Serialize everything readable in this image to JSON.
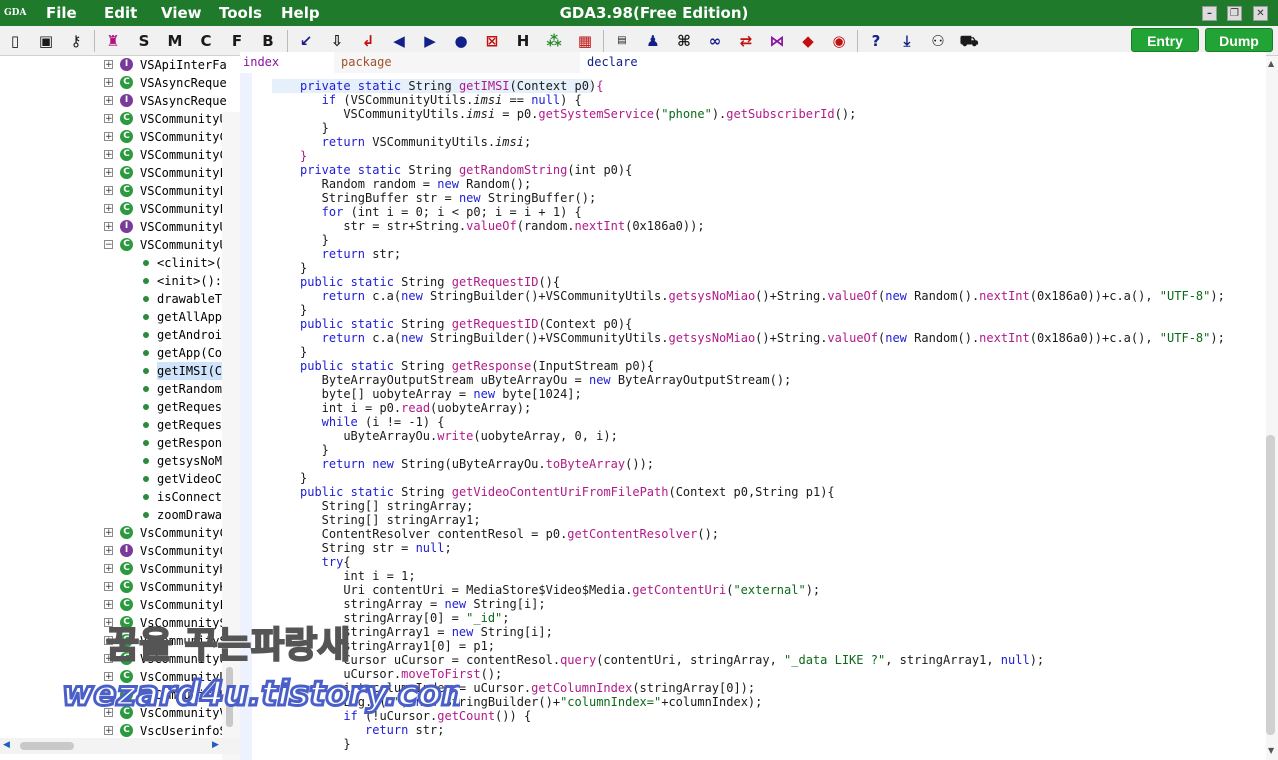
{
  "window": {
    "title": "GDA3.98(Free Edition)",
    "logo_text": "GDA"
  },
  "menu": [
    {
      "label": "File"
    },
    {
      "label": "Edit"
    },
    {
      "label": "View"
    },
    {
      "label": "Tools"
    },
    {
      "label": "Help"
    }
  ],
  "toolbar": {
    "letters": [
      "S",
      "M",
      "C",
      "F",
      "B",
      "H"
    ],
    "icons": [
      "book-icon",
      "save-icon",
      "key-icon",
      "tree-icon",
      "cursor-icon",
      "download-icon",
      "return-icon",
      "arrow-left-icon",
      "arrow-right-icon",
      "android-bot-icon",
      "close-doc-icon",
      "graph-icon",
      "grid-icon",
      "xml-icon",
      "android-icon",
      "command-icon",
      "link-icon",
      "left-right-icon",
      "chain-icon",
      "diamond-icon",
      "coin-icon",
      "help-icon",
      "download-arrow-icon",
      "network-icon",
      "cart-icon"
    ],
    "help_label": "?",
    "entry_label": "Entry",
    "dump_label": "Dump"
  },
  "tabs": {
    "index": "index",
    "package": "package",
    "declare": "declare"
  },
  "tree": {
    "classes_top": [
      {
        "label": "VSApiInterFa",
        "type": "I"
      },
      {
        "label": "VSAsyncReque",
        "type": "C"
      },
      {
        "label": "VSAsyncReque",
        "type": "I"
      },
      {
        "label": "VSCommunityU",
        "type": "C"
      },
      {
        "label": "VSCommunityC",
        "type": "C"
      },
      {
        "label": "VSCommunityC",
        "type": "C"
      },
      {
        "label": "VSCommunityF",
        "type": "C"
      },
      {
        "label": "VSCommunityF",
        "type": "C"
      },
      {
        "label": "VSCommunityF",
        "type": "C"
      },
      {
        "label": "VSCommunityU",
        "type": "I"
      },
      {
        "label": "VSCommunityU",
        "type": "C"
      }
    ],
    "methods": [
      "<clinit>(",
      "<init>():",
      "drawableT",
      "getAllApp",
      "getAndroi",
      "getApp(Co",
      "getIMSI(C",
      "getRandom",
      "getReques",
      "getReques",
      "getRespon",
      "getsysNoM",
      "getVideoC",
      "isConnect",
      "zoomDrawa"
    ],
    "selected_method": "getIMSI(C",
    "classes_bottom": [
      {
        "label": "VsCommunityC",
        "type": "C"
      },
      {
        "label": "VsCommunityC",
        "type": "I"
      },
      {
        "label": "VsCommunityH",
        "type": "C"
      },
      {
        "label": "VsCommunityK",
        "type": "C"
      },
      {
        "label": "VsCommunityF",
        "type": "C"
      },
      {
        "label": "VsCommunityS",
        "type": "C"
      },
      {
        "label": "VsCommunityS",
        "type": "C"
      },
      {
        "label": "VsCommunityU",
        "type": "C"
      },
      {
        "label": "VsCommunityU",
        "type": "C"
      },
      {
        "label": "VsCommunityU",
        "type": "C"
      },
      {
        "label": "VsCommunityV",
        "type": "C"
      },
      {
        "label": "VscUserinfoS",
        "type": "C"
      }
    ]
  },
  "code_lines": [
    {
      "indent": 1,
      "tokens": [
        [
          "k",
          "private static "
        ],
        [
          "",
          "String "
        ],
        [
          "m",
          "getIMSI"
        ],
        [
          "",
          "(Context p0)"
        ],
        [
          "m",
          "{"
        ]
      ]
    },
    {
      "indent": 2,
      "tokens": [
        [
          "k",
          "if "
        ],
        [
          "",
          "(VSCommunityUtils."
        ],
        [
          "f",
          "imsi"
        ],
        [
          "",
          " == "
        ],
        [
          "k",
          "null"
        ],
        [
          "",
          ") {"
        ]
      ]
    },
    {
      "indent": 3,
      "tokens": [
        [
          "",
          "VSCommunityUtils."
        ],
        [
          "f",
          "imsi"
        ],
        [
          "",
          " = p0."
        ],
        [
          "m",
          "getSystemService"
        ],
        [
          "",
          "("
        ],
        [
          "s",
          "\"phone\""
        ],
        [
          "",
          ")."
        ],
        [
          "m",
          "getSubscriberId"
        ],
        [
          "",
          "();"
        ]
      ]
    },
    {
      "indent": 2,
      "tokens": [
        [
          "",
          "}"
        ]
      ]
    },
    {
      "indent": 2,
      "tokens": [
        [
          "k",
          "return "
        ],
        [
          "",
          "VSCommunityUtils."
        ],
        [
          "f",
          "imsi"
        ],
        [
          "",
          ";"
        ]
      ]
    },
    {
      "indent": 1,
      "tokens": [
        [
          "m",
          "}"
        ]
      ]
    },
    {
      "indent": 1,
      "tokens": [
        [
          "k",
          "private static "
        ],
        [
          "",
          "String "
        ],
        [
          "m",
          "getRandomString"
        ],
        [
          "",
          "(int p0){"
        ]
      ]
    },
    {
      "indent": 2,
      "tokens": [
        [
          "",
          "Random random = "
        ],
        [
          "k",
          "new "
        ],
        [
          "",
          "Random();"
        ]
      ]
    },
    {
      "indent": 2,
      "tokens": [
        [
          "",
          "StringBuffer str = "
        ],
        [
          "k",
          "new "
        ],
        [
          "",
          "StringBuffer();"
        ]
      ]
    },
    {
      "indent": 2,
      "tokens": [
        [
          "k",
          "for "
        ],
        [
          "",
          "(int i = 0; i < p0; i = i + 1) {"
        ]
      ]
    },
    {
      "indent": 3,
      "tokens": [
        [
          "",
          "str = str+String."
        ],
        [
          "m",
          "valueOf"
        ],
        [
          "",
          "(random."
        ],
        [
          "m",
          "nextInt"
        ],
        [
          "",
          "(0x186a0));"
        ]
      ]
    },
    {
      "indent": 2,
      "tokens": [
        [
          "",
          "}"
        ]
      ]
    },
    {
      "indent": 2,
      "tokens": [
        [
          "k",
          "return "
        ],
        [
          "",
          "str;"
        ]
      ]
    },
    {
      "indent": 1,
      "tokens": [
        [
          "",
          "}"
        ]
      ]
    },
    {
      "indent": 1,
      "tokens": [
        [
          "k",
          "public static "
        ],
        [
          "",
          "String "
        ],
        [
          "m",
          "getRequestID"
        ],
        [
          "",
          "(){"
        ]
      ]
    },
    {
      "indent": 2,
      "tokens": [
        [
          "k",
          "return "
        ],
        [
          "",
          "c.a("
        ],
        [
          "k",
          "new "
        ],
        [
          "",
          "StringBuilder()+VSCommunityUtils."
        ],
        [
          "m",
          "getsysNoMiao"
        ],
        [
          "",
          "()+String."
        ],
        [
          "m",
          "valueOf"
        ],
        [
          "",
          "("
        ],
        [
          "k",
          "new "
        ],
        [
          "",
          "Random()."
        ],
        [
          "m",
          "nextInt"
        ],
        [
          "",
          "(0x186a0))+c.a(), "
        ],
        [
          "s",
          "\"UTF-8\""
        ],
        [
          "",
          ");"
        ]
      ]
    },
    {
      "indent": 1,
      "tokens": [
        [
          "",
          "}"
        ]
      ]
    },
    {
      "indent": 1,
      "tokens": [
        [
          "k",
          "public static "
        ],
        [
          "",
          "String "
        ],
        [
          "m",
          "getRequestID"
        ],
        [
          "",
          "(Context p0){"
        ]
      ]
    },
    {
      "indent": 2,
      "tokens": [
        [
          "k",
          "return "
        ],
        [
          "",
          "c.a("
        ],
        [
          "k",
          "new "
        ],
        [
          "",
          "StringBuilder()+VSCommunityUtils."
        ],
        [
          "m",
          "getsysNoMiao"
        ],
        [
          "",
          "()+String."
        ],
        [
          "m",
          "valueOf"
        ],
        [
          "",
          "("
        ],
        [
          "k",
          "new "
        ],
        [
          "",
          "Random()."
        ],
        [
          "m",
          "nextInt"
        ],
        [
          "",
          "(0x186a0))+c.a(), "
        ],
        [
          "s",
          "\"UTF-8\""
        ],
        [
          "",
          ");"
        ]
      ]
    },
    {
      "indent": 1,
      "tokens": [
        [
          "",
          "}"
        ]
      ]
    },
    {
      "indent": 1,
      "tokens": [
        [
          "k",
          "public static "
        ],
        [
          "",
          "String "
        ],
        [
          "m",
          "getResponse"
        ],
        [
          "",
          "(InputStream p0){"
        ]
      ]
    },
    {
      "indent": 2,
      "tokens": [
        [
          "",
          "ByteArrayOutputStream uByteArrayOu = "
        ],
        [
          "k",
          "new "
        ],
        [
          "",
          "ByteArrayOutputStream();"
        ]
      ]
    },
    {
      "indent": 2,
      "tokens": [
        [
          "",
          "byte[] uobyteArray = "
        ],
        [
          "k",
          "new "
        ],
        [
          "",
          "byte[1024];"
        ]
      ]
    },
    {
      "indent": 2,
      "tokens": [
        [
          "",
          "int i = p0."
        ],
        [
          "m",
          "read"
        ],
        [
          "",
          "(uobyteArray);"
        ]
      ]
    },
    {
      "indent": 2,
      "tokens": [
        [
          "k",
          "while "
        ],
        [
          "",
          "(i != -1) {"
        ]
      ]
    },
    {
      "indent": 3,
      "tokens": [
        [
          "",
          "uByteArrayOu."
        ],
        [
          "m",
          "write"
        ],
        [
          "",
          "(uobyteArray, 0, i);"
        ]
      ]
    },
    {
      "indent": 2,
      "tokens": [
        [
          "",
          "}"
        ]
      ]
    },
    {
      "indent": 2,
      "tokens": [
        [
          "k",
          "return new "
        ],
        [
          "",
          "String(uByteArrayOu."
        ],
        [
          "m",
          "toByteArray"
        ],
        [
          "",
          "());"
        ]
      ]
    },
    {
      "indent": 1,
      "tokens": [
        [
          "",
          "}"
        ]
      ]
    },
    {
      "indent": 1,
      "tokens": [
        [
          "k",
          "public static "
        ],
        [
          "",
          "String "
        ],
        [
          "m",
          "getVideoContentUriFromFilePath"
        ],
        [
          "",
          "(Context p0,String p1){"
        ]
      ]
    },
    {
      "indent": 2,
      "tokens": [
        [
          "",
          "String[] stringArray;"
        ]
      ]
    },
    {
      "indent": 2,
      "tokens": [
        [
          "",
          "String[] stringArray1;"
        ]
      ]
    },
    {
      "indent": 2,
      "tokens": [
        [
          "",
          "ContentResolver contentResol = p0."
        ],
        [
          "m",
          "getContentResolver"
        ],
        [
          "",
          "();"
        ]
      ]
    },
    {
      "indent": 2,
      "tokens": [
        [
          "",
          "String str = "
        ],
        [
          "k",
          "null"
        ],
        [
          "",
          ";"
        ]
      ]
    },
    {
      "indent": 2,
      "tokens": [
        [
          "k",
          "try"
        ],
        [
          "",
          "{"
        ]
      ]
    },
    {
      "indent": 3,
      "tokens": [
        [
          "",
          "int i = 1;"
        ]
      ]
    },
    {
      "indent": 3,
      "tokens": [
        [
          "",
          "Uri contentUri = MediaStore$Video$Media."
        ],
        [
          "m",
          "getContentUri"
        ],
        [
          "",
          "("
        ],
        [
          "s",
          "\"external\""
        ],
        [
          "",
          ");"
        ]
      ]
    },
    {
      "indent": 3,
      "tokens": [
        [
          "",
          "stringArray = "
        ],
        [
          "k",
          "new "
        ],
        [
          "",
          "String[i];"
        ]
      ]
    },
    {
      "indent": 3,
      "tokens": [
        [
          "",
          "stringArray[0] = "
        ],
        [
          "s",
          "\"_id\""
        ],
        [
          "",
          ";"
        ]
      ]
    },
    {
      "indent": 3,
      "tokens": [
        [
          "",
          "stringArray1 = "
        ],
        [
          "k",
          "new "
        ],
        [
          "",
          "String[i];"
        ]
      ]
    },
    {
      "indent": 3,
      "tokens": [
        [
          "",
          "stringArray1[0] = p1;"
        ]
      ]
    },
    {
      "indent": 3,
      "tokens": [
        [
          "",
          "Cursor uCursor = contentResol."
        ],
        [
          "m",
          "query"
        ],
        [
          "",
          "(contentUri, stringArray, "
        ],
        [
          "s",
          "\"_data LIKE ?\""
        ],
        [
          "",
          ", stringArray1, "
        ],
        [
          "k",
          "null"
        ],
        [
          "",
          ");"
        ]
      ]
    },
    {
      "indent": 3,
      "tokens": [
        [
          "",
          "uCursor."
        ],
        [
          "m",
          "moveToFirst"
        ],
        [
          "",
          "();"
        ]
      ]
    },
    {
      "indent": 3,
      "tokens": [
        [
          "",
          "int columnIndex = uCursor."
        ],
        [
          "m",
          "getColumnIndex"
        ],
        [
          "",
          "(stringArray[0]);"
        ]
      ]
    },
    {
      "indent": 3,
      "tokens": [
        [
          "",
          "Log.d("
        ],
        [
          "s",
          "\"\""
        ],
        [
          "",
          ", "
        ],
        [
          "k",
          "new "
        ],
        [
          "",
          "StringBuilder()+"
        ],
        [
          "s",
          "\"columnIndex=\""
        ],
        [
          "",
          "+columnIndex);"
        ]
      ]
    },
    {
      "indent": 3,
      "tokens": [
        [
          "k",
          "if "
        ],
        [
          "",
          "(!uCursor."
        ],
        [
          "m",
          "getCount"
        ],
        [
          "",
          "()) {"
        ]
      ]
    },
    {
      "indent": 4,
      "tokens": [
        [
          "k",
          "return "
        ],
        [
          "",
          "str;"
        ]
      ]
    },
    {
      "indent": 3,
      "tokens": [
        [
          "",
          "}"
        ]
      ]
    }
  ],
  "watermark": {
    "line1": "꿈을 꾸는파랑새",
    "line2": "wezard4u.tistory.com"
  }
}
